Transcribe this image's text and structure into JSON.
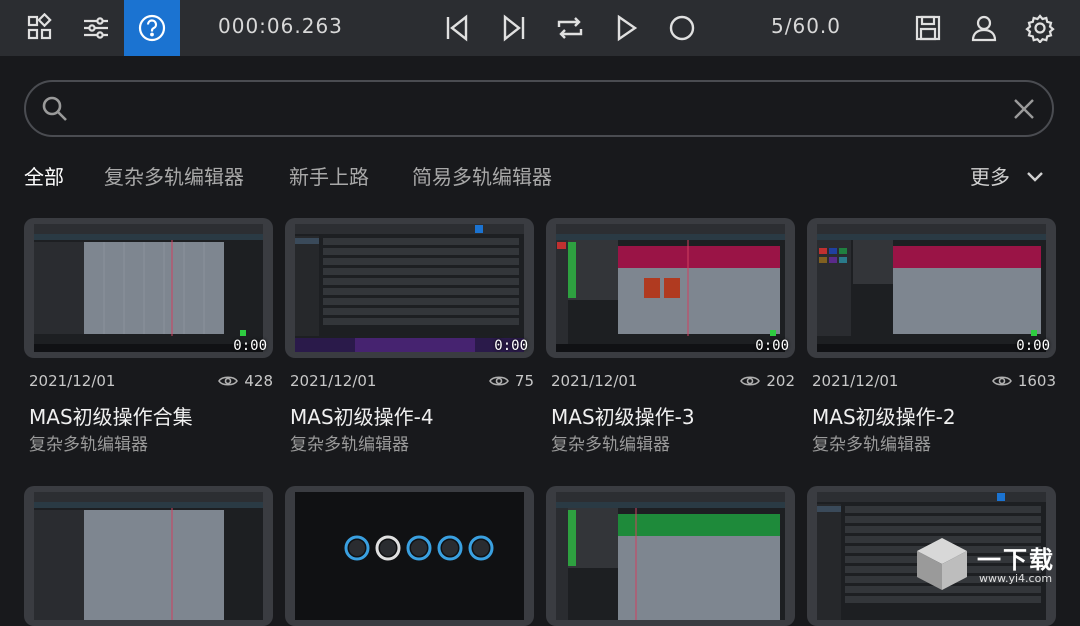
{
  "toolbar": {
    "time": "000:06.263",
    "bars": "5/60.0"
  },
  "search": {
    "placeholder": "",
    "value": ""
  },
  "tabs": [
    {
      "label": "全部",
      "active": true
    },
    {
      "label": "复杂多轨编辑器",
      "active": false
    },
    {
      "label": "新手上路",
      "active": false
    },
    {
      "label": "简易多轨编辑器",
      "active": false
    }
  ],
  "more_label": "更多",
  "cards": [
    {
      "date": "2021/12/01",
      "views": "428",
      "title": "MAS初级操作合集",
      "category": "复杂多轨编辑器",
      "duration": "0:00"
    },
    {
      "date": "2021/12/01",
      "views": "75",
      "title": "MAS初级操作-4",
      "category": "复杂多轨编辑器",
      "duration": "0:00"
    },
    {
      "date": "2021/12/01",
      "views": "202",
      "title": "MAS初级操作-3",
      "category": "复杂多轨编辑器",
      "duration": "0:00"
    },
    {
      "date": "2021/12/01",
      "views": "1603",
      "title": "MAS初级操作-2",
      "category": "复杂多轨编辑器",
      "duration": "0:00"
    }
  ],
  "watermark": {
    "text": "一下载",
    "url": "www.yi4.com"
  },
  "colors": {
    "accent": "#1b73d1",
    "bg": "#18191c",
    "topbar": "#2b2d31",
    "track_red": "#9a1446",
    "track_green": "#1e8a3a"
  },
  "icons": [
    "grid-icon",
    "sliders-icon",
    "help-icon",
    "skip-back-icon",
    "skip-forward-icon",
    "loop-icon",
    "play-icon",
    "record-icon",
    "save-icon",
    "user-icon",
    "gear-icon",
    "search-icon",
    "clear-icon",
    "chevron-down-icon",
    "eye-icon"
  ]
}
